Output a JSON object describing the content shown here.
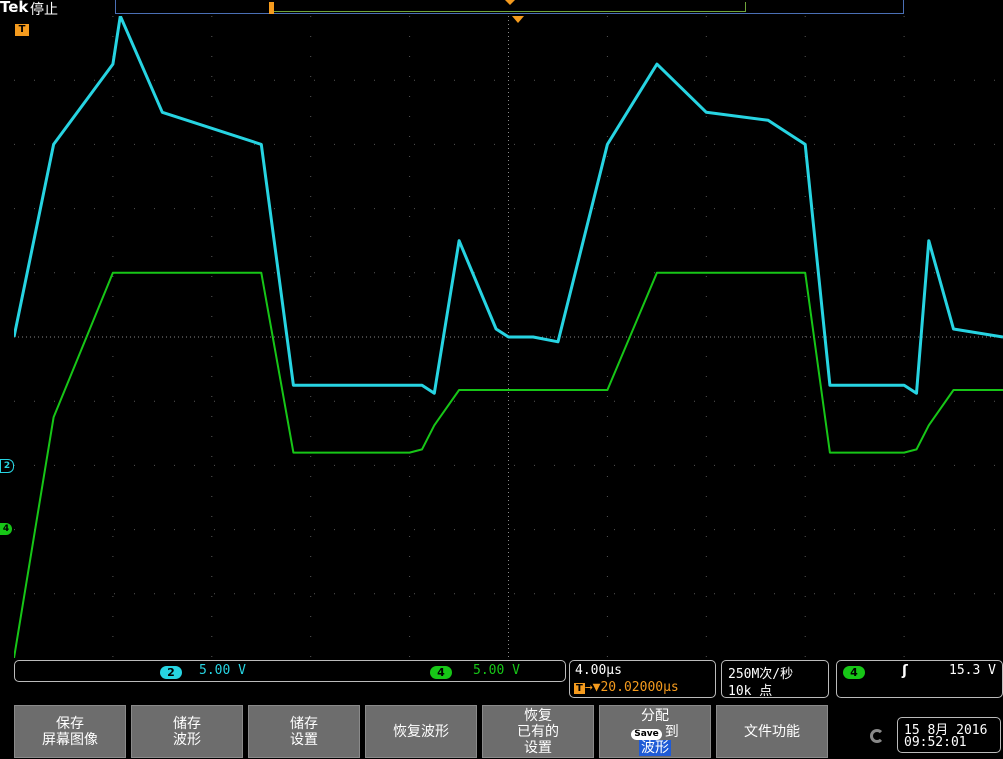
{
  "header": {
    "brand": "Tek",
    "status": "停止"
  },
  "channels": [
    {
      "id": "2",
      "scale": "5.00 V",
      "color": "#27d4e2"
    },
    {
      "id": "4",
      "scale": "5.00 V",
      "color": "#17c617"
    }
  ],
  "horizontal": {
    "timebase": "4.00µs",
    "trigger_position": "20.02000µs"
  },
  "acquisition": {
    "sample_rate": "250M次/秒",
    "record_length": "10k 点"
  },
  "trigger": {
    "source": "4",
    "slope": "rising",
    "level": "15.3 V"
  },
  "menu": {
    "save_screen": [
      "保存",
      "屏幕图像"
    ],
    "save_waveform": [
      "储存",
      "波形"
    ],
    "save_setup": [
      "储存",
      "设置"
    ],
    "recall_waveform": "恢复波形",
    "recall_setup": [
      "恢复",
      "已有的",
      "设置"
    ],
    "assign": [
      "分配",
      "Save",
      "到",
      "波形"
    ],
    "file_utilities": "文件功能"
  },
  "datetime": {
    "date": "15 8月 2016",
    "time": "09:52:01"
  },
  "chart_data": {
    "type": "line",
    "x": [
      0,
      1.6,
      4,
      4.3,
      6,
      7,
      10,
      11.3,
      16,
      16.5,
      17,
      18,
      19.5,
      20,
      21,
      22,
      24,
      26,
      28,
      30.5,
      32,
      33,
      36,
      36.5,
      37,
      38,
      40
    ],
    "x_unit": "µs",
    "xlim": [
      0,
      40
    ],
    "y_unit": "V",
    "ylim": [
      -20,
      20
    ],
    "series": [
      {
        "name": "2",
        "color": "#27d4e2",
        "values": [
          0,
          12,
          17,
          20,
          14,
          13.5,
          12,
          -3,
          -3,
          -3,
          -3.5,
          6,
          0.5,
          0,
          0,
          -0.3,
          12,
          17,
          14,
          13.5,
          12,
          -3,
          -3,
          -3.5,
          6,
          0.5,
          0
        ]
      },
      {
        "name": "4",
        "color": "#17c617",
        "values": [
          -20,
          -5,
          4,
          4,
          4,
          4,
          4,
          -7.2,
          -7.2,
          -7,
          -5.5,
          -3.3,
          -3.3,
          -3.3,
          -3.3,
          -3.3,
          -3.3,
          4,
          4,
          4,
          4,
          -7.2,
          -7.2,
          -7,
          -5.5,
          -3.3,
          -3.3
        ]
      }
    ]
  }
}
